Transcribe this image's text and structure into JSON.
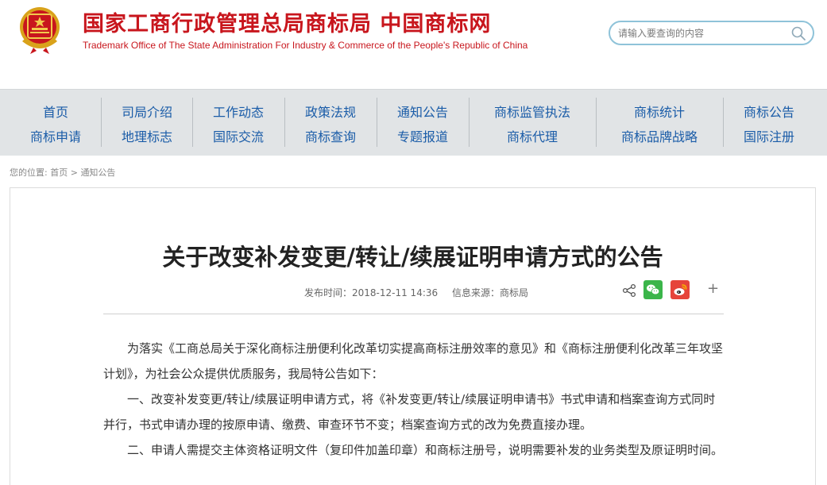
{
  "header": {
    "title": "国家工商行政管理总局商标局 中国商标网",
    "subtitle": "Trademark Office of The State Administration For Industry & Commerce of the People's Republic of China",
    "search_placeholder": "请输入要查询的内容"
  },
  "nav": {
    "columns": [
      {
        "top": "首页",
        "bottom": "商标申请"
      },
      {
        "top": "司局介绍",
        "bottom": "地理标志"
      },
      {
        "top": "工作动态",
        "bottom": "国际交流"
      },
      {
        "top": "政策法规",
        "bottom": "商标查询"
      },
      {
        "top": "通知公告",
        "bottom": "专题报道"
      },
      {
        "top": "商标监管执法",
        "bottom": "商标代理"
      },
      {
        "top": "商标统计",
        "bottom": "商标品牌战略"
      },
      {
        "top": "商标公告",
        "bottom": "国际注册"
      }
    ]
  },
  "breadcrumb": {
    "prefix": "您的位置:",
    "home": "首页",
    "sep": ">",
    "current": "通知公告"
  },
  "article": {
    "title": "关于改变补发变更/转让/续展证明申请方式的公告",
    "publish_time": "发布时间：2018-12-11 14:36",
    "source": "信息来源：商标局",
    "paragraphs": [
      "为落实《工商总局关于深化商标注册便利化改革切实提高商标注册效率的意见》和《商标注册便利化改革三年攻坚计划》，为社会公众提供优质服务，我局特公告如下：",
      "一、改变补发变更/转让/续展证明申请方式，将《补发变更/转让/续展证明申请书》书式申请和档案查询方式同时并行，书式申请办理的按原申请、缴费、审查环节不变；档案查询方式的改为免费直接办理。",
      "二、申请人需提交主体资格证明文件（复印件加盖印章）和商标注册号，说明需要补发的业务类型及原证明时间。"
    ]
  },
  "share": {
    "plus": "+"
  },
  "colors": {
    "brand_red": "#c8161d",
    "nav_blue": "#1a5ca8",
    "nav_bg": "#e1e4e6",
    "wechat_green": "#3bb54a",
    "weibo_red": "#e6443a"
  },
  "icons": [
    "emblem-logo",
    "search-icon",
    "share-icon",
    "wechat-icon",
    "weibo-icon",
    "plus-icon"
  ]
}
